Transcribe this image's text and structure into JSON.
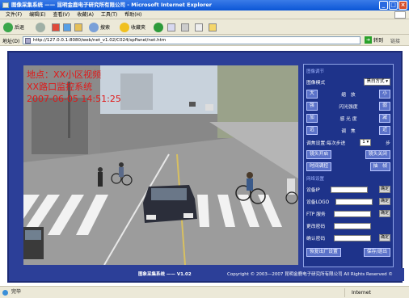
{
  "window": {
    "title": "图像采集系统 —— 昆明金鹿电子研究所有限公司 - Microsoft Internet Explorer"
  },
  "menu": [
    "文件(F)",
    "编辑(E)",
    "查看(V)",
    "收藏(A)",
    "工具(T)",
    "帮助(H)"
  ],
  "toolbar": {
    "back": "后退",
    "search": "搜索",
    "favorites": "收藏夹"
  },
  "address": {
    "label": "地址(D)",
    "url": "http://127.0.0.1:8080/web/net_v1.02/C024/spPanel/net.htm",
    "go": "转到",
    "links": "链接"
  },
  "video": {
    "overlay_line1": "地点：XX小区视频",
    "overlay_line2": "XX路口监控系统",
    "overlay_line3": "2007-06-05 14:51:25"
  },
  "panel": {
    "section1": "图像调节",
    "mode_label": "图像模式",
    "mode_value": "黑白方式",
    "rows": [
      {
        "left": "大",
        "label": "缩　放",
        "right": "小"
      },
      {
        "left": "强",
        "label": "闪光强度",
        "right": "弱"
      },
      {
        "left": "加",
        "label": "感 光 度",
        "right": "减"
      },
      {
        "left": "远",
        "label": "调　焦",
        "right": "近"
      }
    ],
    "step_label": "调焦设置:每次步进",
    "step_value": "1",
    "step_unit": "步",
    "lens_open": "镜头开启",
    "lens_close": "镜头关闭",
    "time_sync": "时间调控",
    "capture": "抽　帧",
    "section2": "网络设置",
    "fields": [
      {
        "label": "设备IP",
        "ok": "确定"
      },
      {
        "label": "设备LOGO",
        "ok": "确定"
      },
      {
        "label": "FTP 服务",
        "ok": "确定"
      },
      {
        "label": "更改密码",
        "ok": ""
      },
      {
        "label": "确认密码",
        "ok": "确定"
      }
    ],
    "restore": "恢复出厂设置",
    "save_exit": "保存/退出"
  },
  "footer": {
    "app": "图象采集系统 —— V1.02",
    "copyright": "Copyright © 2003—2007 昆明金鹿电子研究所有限公司 All Rights Reserved ©"
  },
  "status": {
    "text": "完毕",
    "zone": "Internet"
  }
}
